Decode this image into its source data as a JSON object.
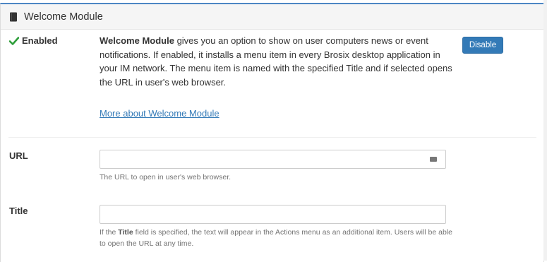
{
  "panel": {
    "title": "Welcome Module",
    "icon": "book-icon"
  },
  "status": {
    "label": "Enabled",
    "icon": "check-icon",
    "color": "#2e9e3a"
  },
  "description": {
    "bold_lead": "Welcome Module",
    "text": " gives you an option to show on user computers news or event notifications. If enabled, it installs a menu item in every Brosix desktop application in your IM network. The menu item is named with the specified Title and if selected opens the URL in user's web browser."
  },
  "more_link": "More about Welcome Module",
  "disable_button": "Disable",
  "url_field": {
    "label": "URL",
    "value": "",
    "placeholder": "",
    "help": "The URL to open in user's web browser."
  },
  "title_field": {
    "label": "Title",
    "value": "",
    "placeholder": "",
    "help_prefix": "If the ",
    "help_bold": "Title",
    "help_suffix": " field is specified, the text will appear in the Actions menu as an additional item. Users will be able to open the URL at any time."
  },
  "colors": {
    "accent": "#337ab7",
    "panel_top_border": "#4d86c4"
  }
}
